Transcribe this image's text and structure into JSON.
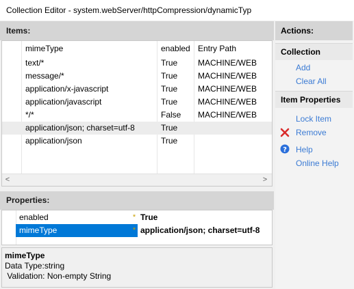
{
  "window": {
    "title": "Collection Editor - system.webServer/httpCompression/dynamicTyp"
  },
  "items": {
    "header": "Items:",
    "columns": [
      "mimeType",
      "enabled",
      "Entry Path"
    ],
    "rows": [
      {
        "mimeType": "text/*",
        "enabled": "True",
        "entry_path": "MACHINE/WEB"
      },
      {
        "mimeType": "message/*",
        "enabled": "True",
        "entry_path": "MACHINE/WEB"
      },
      {
        "mimeType": "application/x-javascript",
        "enabled": "True",
        "entry_path": "MACHINE/WEB"
      },
      {
        "mimeType": "application/javascript",
        "enabled": "True",
        "entry_path": "MACHINE/WEB"
      },
      {
        "mimeType": "*/*",
        "enabled": "False",
        "entry_path": "MACHINE/WEB"
      },
      {
        "mimeType": "application/json; charset=utf-8",
        "enabled": "True",
        "entry_path": ""
      },
      {
        "mimeType": "application/json",
        "enabled": "True",
        "entry_path": ""
      }
    ],
    "scroll_left": "<",
    "scroll_right": ">"
  },
  "properties": {
    "header": "Properties:",
    "rows": [
      {
        "name": "enabled",
        "value": "True",
        "mark": "*"
      },
      {
        "name": "mimeType",
        "value": "application/json; charset=utf-8",
        "mark": "*"
      }
    ]
  },
  "description": {
    "title": "mimeType",
    "line1": "Data Type:string",
    "line2": " Validation: Non-empty String"
  },
  "actions": {
    "header": "Actions:",
    "collection_title": "Collection",
    "add": "Add",
    "clear_all": "Clear All",
    "item_properties_title": "Item Properties",
    "lock_item": "Lock Item",
    "remove": "Remove",
    "help": "Help",
    "online_help": "Online Help"
  },
  "colors": {
    "link": "#3b7bd4",
    "selection": "#0078d7",
    "remove_icon": "#d92b2b",
    "help_icon": "#2a6fdb"
  }
}
